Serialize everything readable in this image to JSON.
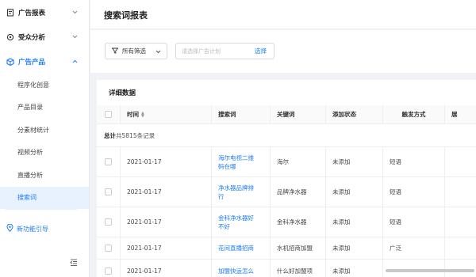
{
  "sidebar": {
    "groups": [
      {
        "label": "广告报表",
        "icon": "report-icon"
      },
      {
        "label": "受众分析",
        "icon": "audience-icon"
      },
      {
        "label": "广告产品",
        "icon": "cube-icon"
      }
    ],
    "sub_items": [
      {
        "label": "程序化创意"
      },
      {
        "label": "产品目录"
      },
      {
        "label": "分素材统计"
      },
      {
        "label": "视频分析"
      },
      {
        "label": "直播分析"
      },
      {
        "label": "搜索词"
      }
    ],
    "guide_label": "新功能引导",
    "accent": "#1b7cf3",
    "selected_bg": "#e8f2fe"
  },
  "page": {
    "title": "搜索词报表"
  },
  "filters": {
    "all_filters_label": "所有筛选",
    "plan_placeholder": "请选择广告计划",
    "select_label": "选择"
  },
  "card": {
    "title": "详细数据"
  },
  "table": {
    "columns": [
      "时间",
      "搜索词",
      "关键词",
      "添加状态",
      "触发方式",
      "展"
    ],
    "total_prefix": "总计",
    "total_text": "共5815条记录",
    "rows": [
      {
        "date": "2021-01-17",
        "search_term": "海尔电视二维码在哪",
        "keyword": "海尔",
        "status": "未添加",
        "trigger": "短语"
      },
      {
        "date": "2021-01-17",
        "search_term": "净水器品牌排行",
        "keyword": "品牌净水器",
        "status": "未添加",
        "trigger": "短语"
      },
      {
        "date": "2021-01-17",
        "search_term": "金科净水器好不好",
        "keyword": "金科净水器",
        "status": "未添加",
        "trigger": "短语"
      },
      {
        "date": "2021-01-17",
        "search_term": "花间直播招商",
        "keyword": "水机招商加盟",
        "status": "未添加",
        "trigger": "广泛"
      },
      {
        "date": "2021-01-17",
        "search_term": "加盟快运怎么",
        "keyword": "什么好加盟项",
        "status": "未添加",
        "trigger": ""
      }
    ]
  }
}
